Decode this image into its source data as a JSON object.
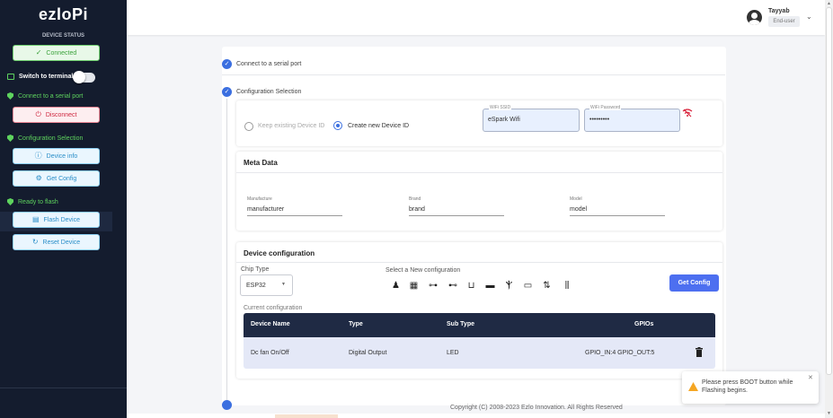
{
  "sidebar": {
    "logo": "ezloPi",
    "device_status_label": "DEVICE STATUS",
    "connected_label": "Connected",
    "switch_terminal_label": "Switch to terminal",
    "steps": {
      "serial": "Connect to a serial port",
      "config": "Configuration Selection",
      "flash": "Ready to flash"
    },
    "buttons": {
      "disconnect": "Disconnect",
      "device_info": "Device info",
      "get_config": "Get Config",
      "flash_device": "Flash Device",
      "reset_device": "Reset Device"
    }
  },
  "header": {
    "user_name": "Tayyab",
    "user_role": "End-user"
  },
  "steps": {
    "serial_port": "Connect to a serial port",
    "config_selection": "Configuration Selection"
  },
  "device_id": {
    "keep_label": "Keep existing Device ID",
    "create_label": "Create new Device ID",
    "selected": "create"
  },
  "wifi": {
    "ssid_label": "WiFi SSID",
    "ssid_value": "eSpark Wifi",
    "password_label": "WiFi Password",
    "password_value": "•••••••••"
  },
  "meta": {
    "title": "Meta Data",
    "manufacturer_label": "Manufacture",
    "manufacturer_value": "manufacturer",
    "brand_label": "Brand",
    "brand_value": "brand",
    "model_label": "Model",
    "model_value": "model"
  },
  "device_config": {
    "title": "Device configuration",
    "chip_type_label": "Chip Type",
    "chip_type_value": "ESP32",
    "select_label": "Select a New configuration",
    "get_config_label": "Get Config",
    "current_label": "Current configuration",
    "columns": [
      "Device Name",
      "Type",
      "Sub Type",
      "GPIOs"
    ],
    "rows": [
      {
        "name": "Dc fan On/Off",
        "type": "Digital Output",
        "sub_type": "LED",
        "gpios": "GPIO_IN:4 GPIO_OUT:5"
      }
    ]
  },
  "footer": "Copyright (C) 2008-2023 Ezlo Innovation. All Rights Reserved",
  "toast": {
    "message": "Please press BOOT button while Flashing begins."
  },
  "colors": {
    "sidebar_bg": "#141c2e",
    "accent": "#4d6ff0",
    "success": "#5ed35e",
    "danger": "#cf2840",
    "table_header": "#1f2a44"
  }
}
